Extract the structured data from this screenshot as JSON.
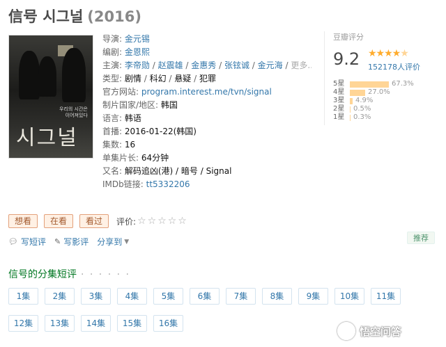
{
  "title": {
    "name": "信号 시그널",
    "year": "(2016)"
  },
  "poster": {
    "title_text": "시그널",
    "caption": "우리의 시간은\n이어져있다"
  },
  "info": {
    "director_label": "导演:",
    "director": "金元锡",
    "writer_label": "编剧:",
    "writer": "金恩熙",
    "cast_label": "主演:",
    "cast": [
      "李帝勋",
      "赵震雄",
      "金惠秀",
      "张铉诚",
      "金元海"
    ],
    "cast_more": "更多...",
    "genre_label": "类型:",
    "genres": [
      "剧情",
      "科幻",
      "悬疑",
      "犯罪"
    ],
    "site_label": "官方网站:",
    "site": "program.interest.me/tvn/signal",
    "country_label": "制片国家/地区:",
    "country": "韩国",
    "language_label": "语言:",
    "language": "韩语",
    "premiere_label": "首播:",
    "premiere": "2016-01-22(韩国)",
    "episodes_label": "集数:",
    "episodes": "16",
    "runtime_label": "单集片长:",
    "runtime": "64分钟",
    "aka_label": "又名:",
    "aka": "解码追凶(港) / 暗号 / Signal",
    "imdb_label": "IMDb链接:",
    "imdb": "tt5332206"
  },
  "rating": {
    "label": "豆瓣评分",
    "score": "9.2",
    "stars_value": 4.5,
    "votes": "152178人评价",
    "breakdown": [
      {
        "label": "5星",
        "pct": "67.3%",
        "value": 67.3
      },
      {
        "label": "4星",
        "pct": "27.0%",
        "value": 27.0
      },
      {
        "label": "3星",
        "pct": "4.9%",
        "value": 4.9
      },
      {
        "label": "2星",
        "pct": "0.5%",
        "value": 0.5
      },
      {
        "label": "1星",
        "pct": "0.3%",
        "value": 0.3
      }
    ]
  },
  "buttons": {
    "want": "想看",
    "watching": "在看",
    "watched": "看过",
    "rate_label": "评价:"
  },
  "actions": {
    "short_review": "写短评",
    "review": "写影评",
    "share": "分享到",
    "recommend": "推荐"
  },
  "episodes_section": {
    "title": "信号的分集短评",
    "dots": "· · · · · ·",
    "items": [
      "1集",
      "2集",
      "3集",
      "4集",
      "5集",
      "6集",
      "7集",
      "8集",
      "9集",
      "10集",
      "11集",
      "12集",
      "13集",
      "14集",
      "15集",
      "16集"
    ]
  },
  "watermark": {
    "text": "悟空问答"
  },
  "colors": {
    "link": "#3377aa",
    "section_green": "#007722",
    "star": "#ffac2d",
    "bar": "#ffd596"
  }
}
